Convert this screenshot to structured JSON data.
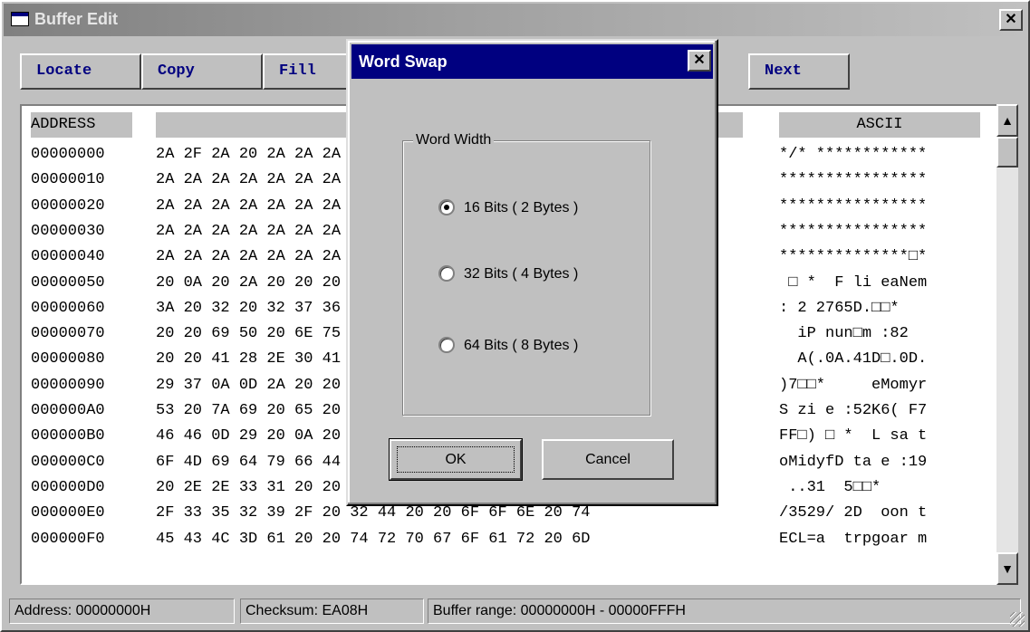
{
  "window": {
    "title": "Buffer Edit",
    "close_glyph": "✕"
  },
  "toolbar": {
    "locate": "Locate",
    "copy": "Copy",
    "fill": "Fill",
    "next": "Next"
  },
  "table": {
    "headers": {
      "address": "ADDRESS",
      "ascii": "ASCII"
    },
    "rows": [
      {
        "addr": "00000000",
        "hex": "2A 2F 2A 20 2A 2A 2A 2A 2A 2A 2A 2A 2A 2A 2A 2A",
        "ascii": "*/* ************"
      },
      {
        "addr": "00000010",
        "hex": "2A 2A 2A 2A 2A 2A 2A 2A 2A 2A 2A 2A 2A 2A 2A 2A",
        "ascii": "****************"
      },
      {
        "addr": "00000020",
        "hex": "2A 2A 2A 2A 2A 2A 2A 2A 2A 2A 2A 2A 2A 2A 2A 2A",
        "ascii": "****************"
      },
      {
        "addr": "00000030",
        "hex": "2A 2A 2A 2A 2A 2A 2A 2A 2A 2A 2A 2A 2A 2A 2A 2A",
        "ascii": "****************"
      },
      {
        "addr": "00000040",
        "hex": "2A 2A 2A 2A 2A 2A 2A 2A 2A 2A 2A 2A 2A 0D 0A 2A",
        "ascii": "**************□*"
      },
      {
        "addr": "00000050",
        "hex": "20 0A 20 2A 20 20 20 46 20 6C 69 20 65 61 4E 65 6D",
        "ascii": " □ *  F li eaNem"
      },
      {
        "addr": "00000060",
        "hex": "3A 20 32 20 32 37 36 35 44 2E 0D 0A 2A 20 20 20 20",
        "ascii": ": 2 2765D.□□*"
      },
      {
        "addr": "00000070",
        "hex": "20 20 69 50 20 6E 75 6E 0D 6D 20 3A 38 32 20 20 20",
        "ascii": "  iP nun□m :82"
      },
      {
        "addr": "00000080",
        "hex": "20 20 41 28 2E 30 41 2E 34 31 44 0D 2E 30 44 2E 2E",
        "ascii": "  A(.0A.41D□.0D."
      },
      {
        "addr": "00000090",
        "hex": "29 37 0A 0D 2A 20 20 20 20 20 65 4D 6F 6D 79 72 72",
        "ascii": ")7□□*     eMomyr"
      },
      {
        "addr": "000000A0",
        "hex": "53 20 7A 69 20 65 20 3A 35 32 4B 36 28 20 46 37 37",
        "ascii": "S zi e :52K6( F7"
      },
      {
        "addr": "000000B0",
        "hex": "46 46 0D 29 20 0A 20 2A 20 20 4C 20 73 61 20 74 74",
        "ascii": "FF□) □ *  L sa t"
      },
      {
        "addr": "000000C0",
        "hex": "6F 4D 69 64 79 66 44 20 74 61 20 65 20 3A 31 39 39",
        "ascii": "oMidyfD ta e :19"
      },
      {
        "addr": "000000D0",
        "hex": "20 2E 2E 33 31 20 20 35 35 0A 0D 2A 20 20 20 20 20",
        "ascii": " ..31  5□□*"
      },
      {
        "addr": "000000E0",
        "hex": "2F 33 35 32 39 2F 20 32 44 20 20 6F 6F 6E 20 74",
        "ascii": "/3529/ 2D  oon t"
      },
      {
        "addr": "000000F0",
        "hex": "45 43 4C 3D 61 20 20 74 72 70 67 6F 61 72 20 6D",
        "ascii": "ECL=a  trpgoar m"
      }
    ]
  },
  "status": {
    "address": "Address: 00000000H",
    "checksum": "Checksum: EA08H",
    "range": "Buffer range: 00000000H - 00000FFFH"
  },
  "dialog": {
    "title": "Word Swap",
    "close_glyph": "✕",
    "group_label": "Word Width",
    "options": [
      {
        "label": "16 Bits ( 2 Bytes )",
        "selected": true
      },
      {
        "label": "32 Bits ( 4 Bytes )",
        "selected": false
      },
      {
        "label": "64 Bits ( 8 Bytes )",
        "selected": false
      }
    ],
    "ok": "OK",
    "cancel": "Cancel"
  },
  "scrollbar": {
    "up_glyph": "▲",
    "down_glyph": "▼"
  }
}
